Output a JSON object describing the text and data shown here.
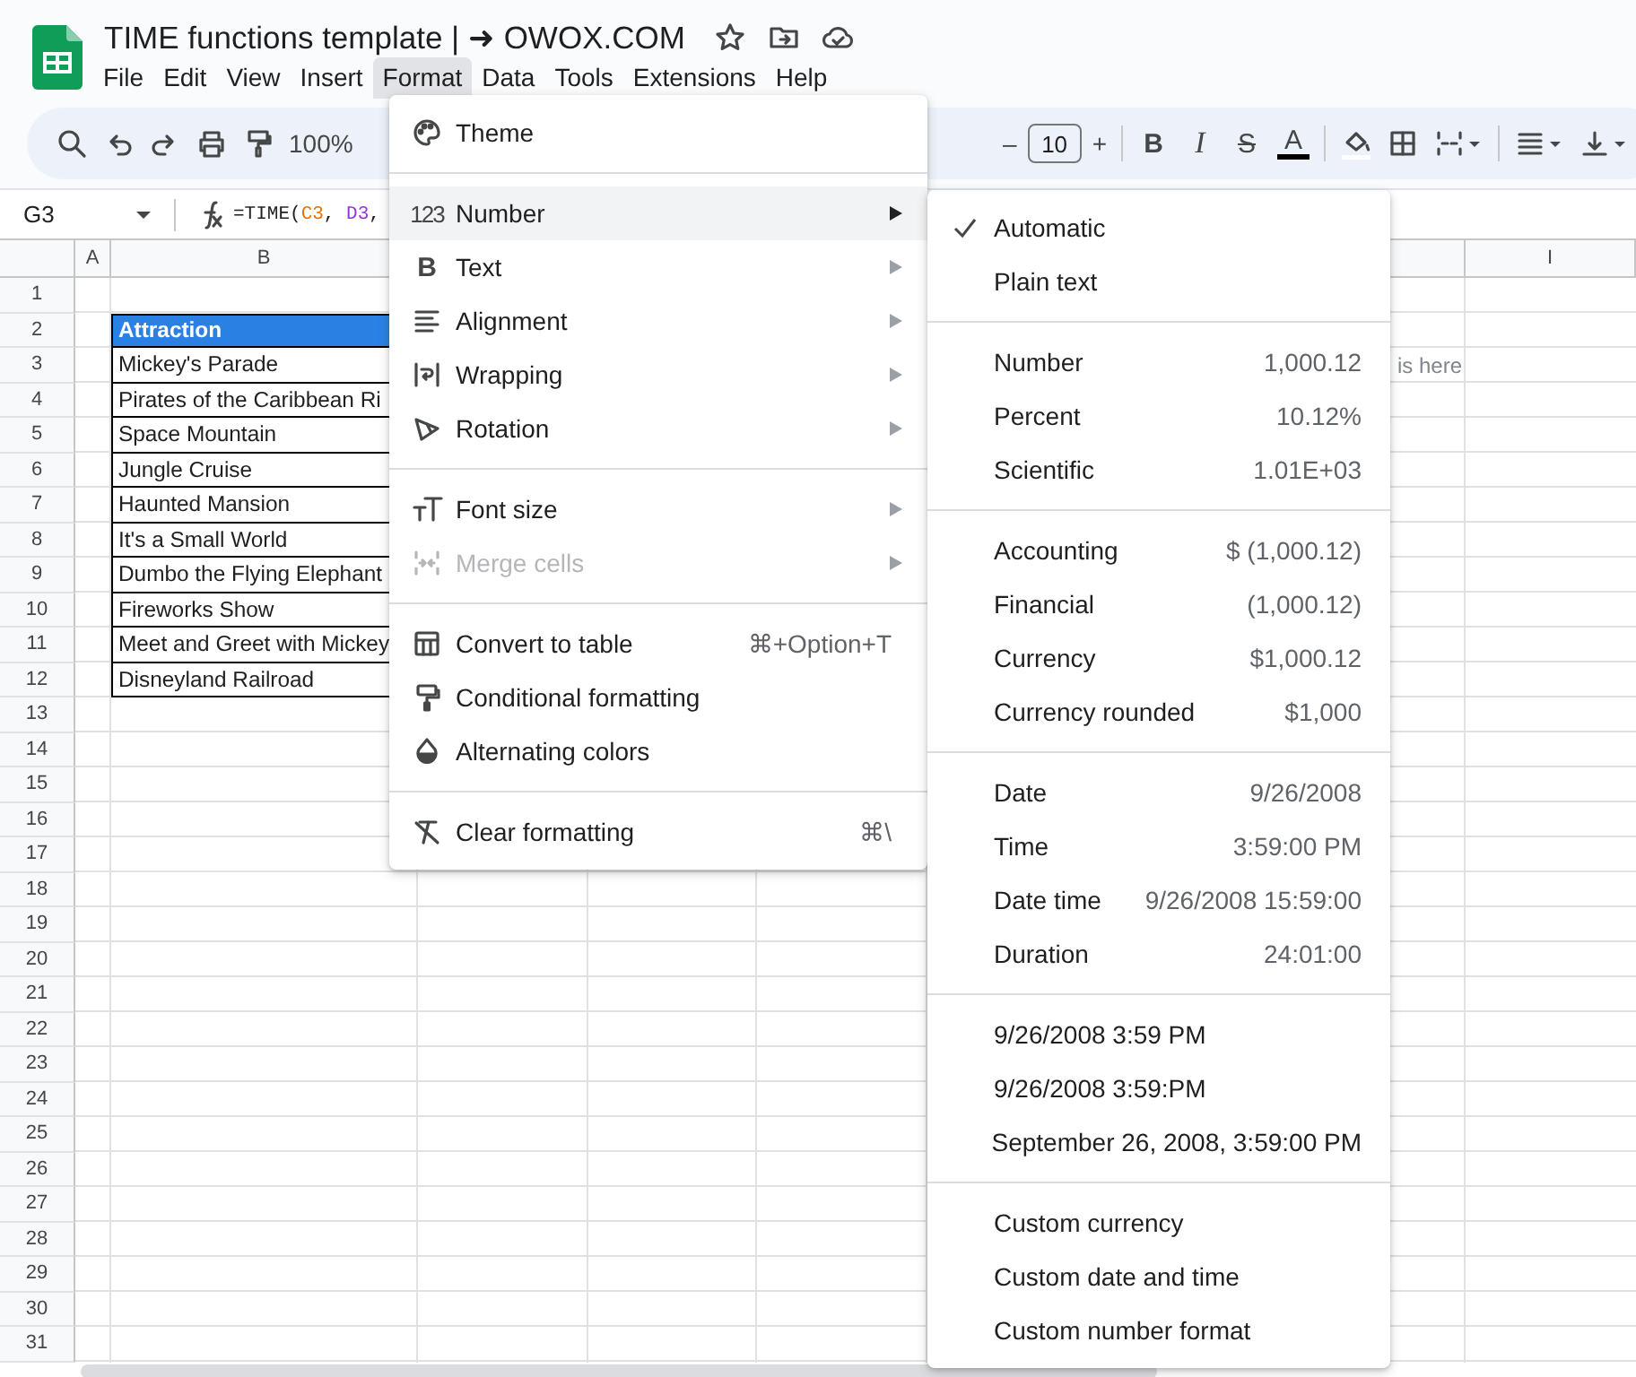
{
  "app": {
    "title": "TIME functions template | ➜ OWOX.COM"
  },
  "menu_bar": [
    {
      "label": "File",
      "selected": false
    },
    {
      "label": "Edit",
      "selected": false
    },
    {
      "label": "View",
      "selected": false
    },
    {
      "label": "Insert",
      "selected": false
    },
    {
      "label": "Format",
      "selected": true
    },
    {
      "label": "Data",
      "selected": false
    },
    {
      "label": "Tools",
      "selected": false
    },
    {
      "label": "Extensions",
      "selected": false
    },
    {
      "label": "Help",
      "selected": false
    }
  ],
  "toolbar": {
    "zoom": "100%",
    "font_size": {
      "minus": "–",
      "value": "10",
      "plus": "+"
    },
    "bold": "B",
    "italic": "I",
    "strikethrough": "S",
    "text_color": "A"
  },
  "formula_bar": {
    "cell_ref": "G3",
    "formula": [
      {
        "text": "=TIME("
      },
      {
        "text": "C3",
        "color": "#e8710a"
      },
      {
        "text": ", "
      },
      {
        "text": "D3",
        "color": "#9334e6"
      },
      {
        "text": ","
      }
    ]
  },
  "sheet": {
    "columns": [
      "A",
      "B",
      "I"
    ],
    "row_numbers": [
      "1",
      "2",
      "3",
      "4",
      "5",
      "6",
      "7",
      "8",
      "9",
      "10",
      "11",
      "12",
      "13",
      "14",
      "15",
      "16",
      "17",
      "18",
      "19",
      "20",
      "21",
      "22",
      "23",
      "24",
      "25",
      "26",
      "27",
      "28",
      "29",
      "30",
      "31"
    ],
    "table": {
      "header": "Attraction",
      "rows": [
        "Mickey's Parade",
        "Pirates of the Caribbean Ri",
        "Space Mountain",
        "Jungle Cruise",
        "Haunted Mansion",
        "It's a Small World",
        "Dumbo the Flying Elephant",
        "Fireworks Show",
        "Meet and Greet with Mickey",
        "Disneyland Railroad"
      ]
    },
    "spill_text": "is here"
  },
  "format_menu": {
    "sections": [
      [
        {
          "label": "Theme",
          "submenu": false,
          "selected": false,
          "disabled": false
        }
      ],
      [
        {
          "label": "Number",
          "glyph": "123",
          "submenu": true,
          "selected": true,
          "disabled": false
        },
        {
          "label": "Text",
          "glyph": "B",
          "submenu": true,
          "selected": false,
          "disabled": false
        },
        {
          "label": "Alignment",
          "submenu": true,
          "selected": false,
          "disabled": false
        },
        {
          "label": "Wrapping",
          "submenu": true,
          "selected": false,
          "disabled": false
        },
        {
          "label": "Rotation",
          "submenu": true,
          "selected": false,
          "disabled": false
        }
      ],
      [
        {
          "label": "Font size",
          "submenu": true,
          "selected": false,
          "disabled": false
        },
        {
          "label": "Merge cells",
          "submenu": true,
          "selected": false,
          "disabled": true
        }
      ],
      [
        {
          "label": "Convert to table",
          "shortcut": "⌘+Option+T",
          "submenu": false,
          "selected": false,
          "disabled": false
        },
        {
          "label": "Conditional formatting",
          "submenu": false,
          "selected": false,
          "disabled": false
        },
        {
          "label": "Alternating colors",
          "submenu": false,
          "selected": false,
          "disabled": false
        }
      ],
      [
        {
          "label": "Clear formatting",
          "shortcut": "⌘\\",
          "submenu": false,
          "selected": false,
          "disabled": false
        }
      ]
    ]
  },
  "number_submenu": {
    "sections": [
      [
        {
          "label": "Automatic",
          "checked": true
        },
        {
          "label": "Plain text",
          "checked": false
        }
      ],
      [
        {
          "label": "Number",
          "sample": "1,000.12",
          "checked": false
        },
        {
          "label": "Percent",
          "sample": "10.12%",
          "checked": false
        },
        {
          "label": "Scientific",
          "sample": "1.01E+03",
          "checked": false
        }
      ],
      [
        {
          "label": "Accounting",
          "sample": "$ (1,000.12)",
          "checked": false
        },
        {
          "label": "Financial",
          "sample": "(1,000.12)",
          "checked": false
        },
        {
          "label": "Currency",
          "sample": "$1,000.12",
          "checked": false
        },
        {
          "label": "Currency rounded",
          "sample": "$1,000",
          "checked": false
        }
      ],
      [
        {
          "label": "Date",
          "sample": "9/26/2008",
          "checked": false
        },
        {
          "label": "Time",
          "sample": "3:59:00 PM",
          "checked": false
        },
        {
          "label": "Date time",
          "sample": "9/26/2008 15:59:00",
          "checked": false
        },
        {
          "label": "Duration",
          "sample": "24:01:00",
          "checked": false
        }
      ],
      [
        {
          "label": "9/26/2008 3:59 PM",
          "checked": false
        },
        {
          "label": "9/26/2008 3:59:PM",
          "checked": false
        },
        {
          "label": "September 26, 2008, 3:59:00 PM",
          "checked": false
        }
      ],
      [
        {
          "label": "Custom currency",
          "checked": false
        },
        {
          "label": "Custom date and time",
          "checked": false
        },
        {
          "label": "Custom number format",
          "checked": false
        }
      ]
    ]
  }
}
